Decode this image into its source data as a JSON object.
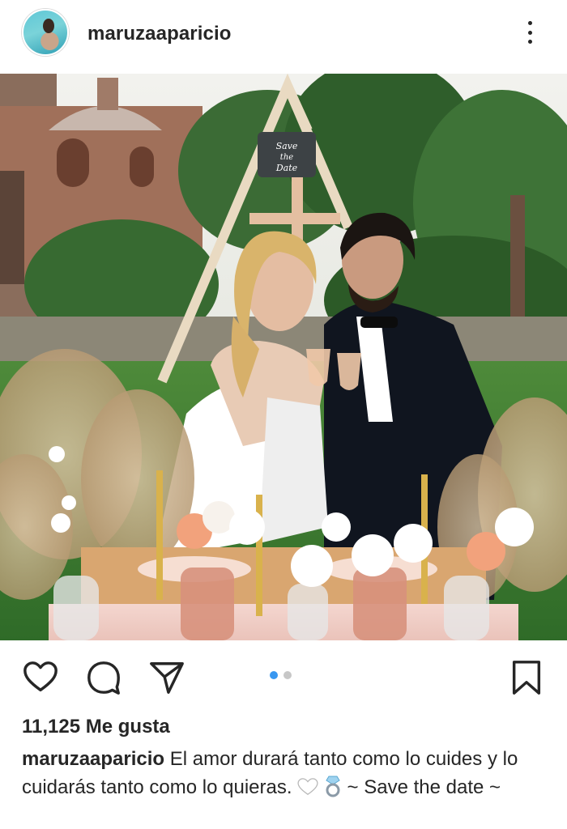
{
  "post": {
    "username": "maruzaaparicio",
    "more_icon": "more-vertical-icon",
    "likes_text": "11,125 Me gusta",
    "caption_user": "maruzaaparicio",
    "caption_text_1": "El amor durará tanto como lo cuides y lo cuidarás tanto como lo quieras.",
    "caption_emoji_1": "white-heart",
    "caption_emoji_2": "ring",
    "caption_text_2": "~ Save the date ~",
    "sign_text_1": "Save",
    "sign_text_2": "the",
    "sign_text_3": "Date",
    "carousel": {
      "total": 2,
      "current": 1
    }
  },
  "actions": [
    "heart-icon",
    "comment-icon",
    "share-icon",
    "bookmark-icon"
  ],
  "colors": {
    "accent": "#3897f0",
    "text": "#262626",
    "inactive_dot": "#c7c7c7"
  }
}
